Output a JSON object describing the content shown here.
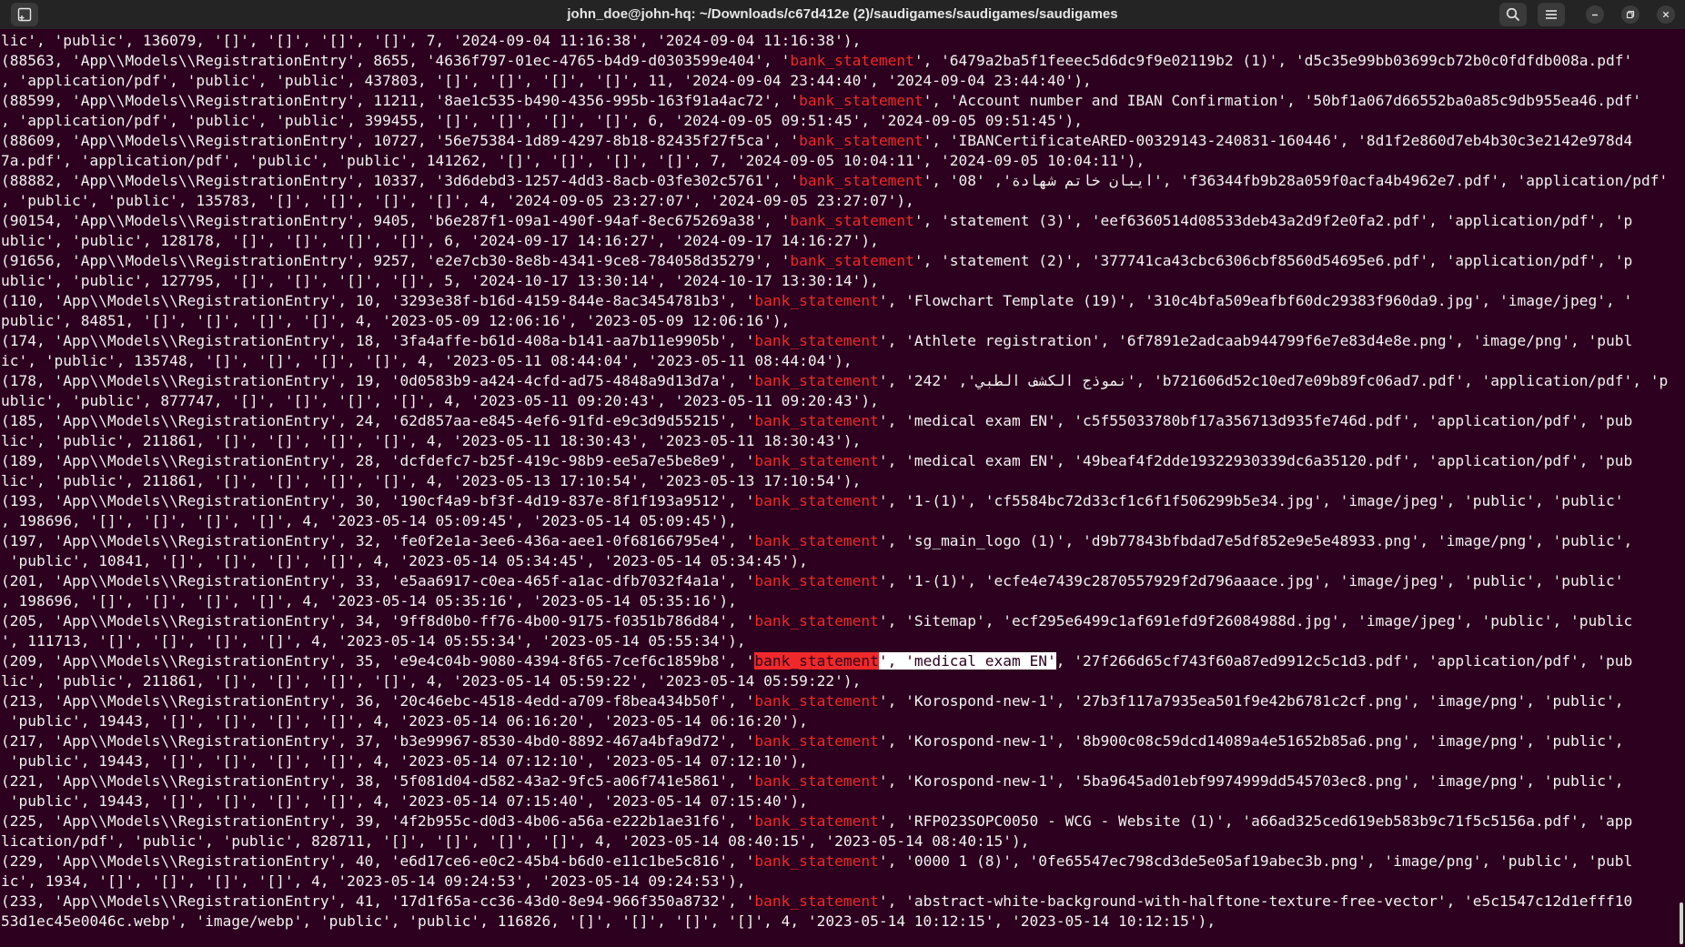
{
  "window": {
    "title": "john_doe@john-hq: ~/Downloads/c67d412e (2)/saudigames/saudigames/saudigames"
  },
  "icons": {
    "new_tab": "new-tab-icon",
    "search": "search-icon",
    "menu": "hamburger-menu-icon",
    "minimize": "minimize-icon",
    "maximize": "maximize-icon",
    "close": "close-icon"
  },
  "colors": {
    "background": "#2c001e",
    "highlight": "#ef2929",
    "text": "#f2f2f2"
  },
  "terminal": {
    "lines": [
      [
        {
          "t": "lic', 'public', 136079, '[]', '[]', '[]', '[]', 7, '2024-09-04 11:16:38', '2024-09-04 11:16:38'),"
        }
      ],
      [
        {
          "t": "(88563, 'App\\\\Models\\\\RegistrationEntry', 8655, '4636f797-01ec-4765-b4d9-d0303599e404', '"
        },
        {
          "t": "bank_statement",
          "c": "hl"
        },
        {
          "t": "', '6479a2ba5f1feeec5d6dc9f9e02119b2 (1)', 'd5c35e99bb03699cb72b0c0fdfdb008a.pdf'"
        }
      ],
      [
        {
          "t": ", 'application/pdf', 'public', 'public', 437803, '[]', '[]', '[]', '[]', 11, '2024-09-04 23:44:40', '2024-09-04 23:44:40'),"
        }
      ],
      [
        {
          "t": "(88599, 'App\\\\Models\\\\RegistrationEntry', 11211, '8ae1c535-b490-4356-995b-163f91a4ac72', '"
        },
        {
          "t": "bank_statement",
          "c": "hl"
        },
        {
          "t": "', 'Account number and IBAN Confirmation', '50bf1a067d66552ba0a85c9db955ea46.pdf'"
        }
      ],
      [
        {
          "t": ", 'application/pdf', 'public', 'public', 399455, '[]', '[]', '[]', '[]', 6, '2024-09-05 09:51:45', '2024-09-05 09:51:45'),"
        }
      ],
      [
        {
          "t": "(88609, 'App\\\\Models\\\\RegistrationEntry', 10727, '56e75384-1d89-4297-8b18-82435f27f5ca', '"
        },
        {
          "t": "bank_statement",
          "c": "hl"
        },
        {
          "t": "', 'IBANCertificateARED-00329143-240831-160446', '8d1f2e860d7eb4b30c3e2142e978d4"
        }
      ],
      [
        {
          "t": "7a.pdf', 'application/pdf', 'public', 'public', 141262, '[]', '[]', '[]', '[]', 7, '2024-09-05 10:04:11', '2024-09-05 10:04:11'),"
        }
      ],
      [
        {
          "t": "(88882, 'App\\\\Models\\\\RegistrationEntry', 10337, '3d6debd3-1257-4dd3-8acb-03fe302c5761', '"
        },
        {
          "t": "bank_statement",
          "c": "hl"
        },
        {
          "t": "', '08' ,'ايبان خاتم شهادة', 'f36344fb9b28a059f0acfa4b4962e7.pdf', 'application/pdf'"
        }
      ],
      [
        {
          "t": ", 'public', 'public', 135783, '[]', '[]', '[]', '[]', 4, '2024-09-05 23:27:07', '2024-09-05 23:27:07'),"
        }
      ],
      [
        {
          "t": "(90154, 'App\\\\Models\\\\RegistrationEntry', 9405, 'b6e287f1-09a1-490f-94af-8ec675269a38', '"
        },
        {
          "t": "bank_statement",
          "c": "hl"
        },
        {
          "t": "', 'statement (3)', 'eef6360514d08533deb43a2d9f2e0fa2.pdf', 'application/pdf', 'p"
        }
      ],
      [
        {
          "t": "ublic', 'public', 128178, '[]', '[]', '[]', '[]', 6, '2024-09-17 14:16:27', '2024-09-17 14:16:27'),"
        }
      ],
      [
        {
          "t": "(91656, 'App\\\\Models\\\\RegistrationEntry', 9257, 'e2e7cb30-8e8b-4341-9ce8-784058d35279', '"
        },
        {
          "t": "bank_statement",
          "c": "hl"
        },
        {
          "t": "', 'statement (2)', '377741ca43cbc6306cbf8560d54695e6.pdf', 'application/pdf', 'p"
        }
      ],
      [
        {
          "t": "ublic', 'public', 127795, '[]', '[]', '[]', '[]', 5, '2024-10-17 13:30:14', '2024-10-17 13:30:14'),"
        }
      ],
      [
        {
          "t": "(110, 'App\\\\Models\\\\RegistrationEntry', 10, '3293e38f-b16d-4159-844e-8ac3454781b3', '"
        },
        {
          "t": "bank_statement",
          "c": "hl"
        },
        {
          "t": "', 'Flowchart Template (19)', '310c4bfa509eafbf60dc29383f960da9.jpg', 'image/jpeg', '"
        }
      ],
      [
        {
          "t": "public', 84851, '[]', '[]', '[]', '[]', 4, '2023-05-09 12:06:16', '2023-05-09 12:06:16'),"
        }
      ],
      [
        {
          "t": "(174, 'App\\\\Models\\\\RegistrationEntry', 18, '3fa4affe-b61d-408a-b141-aa7b11e9905b', '"
        },
        {
          "t": "bank_statement",
          "c": "hl"
        },
        {
          "t": "', 'Athlete registration', '6f7891e2adcaab944799f6e7e83d4e8e.png', 'image/png', 'publ"
        }
      ],
      [
        {
          "t": "ic', 'public', 135748, '[]', '[]', '[]', '[]', 4, '2023-05-11 08:44:04', '2023-05-11 08:44:04'),"
        }
      ],
      [
        {
          "t": "(178, 'App\\\\Models\\\\RegistrationEntry', 19, '0d0583b9-a424-4cfd-ad75-4848a9d13d7a', '"
        },
        {
          "t": "bank_statement",
          "c": "hl"
        },
        {
          "t": "', '242' ,'نموذج الكشف الطبي', 'b721606d52c10ed7e09b89fc06ad7.pdf', 'application/pdf', 'p"
        }
      ],
      [
        {
          "t": "ublic', 'public', 877747, '[]', '[]', '[]', '[]', 4, '2023-05-11 09:20:43', '2023-05-11 09:20:43'),"
        }
      ],
      [
        {
          "t": "(185, 'App\\\\Models\\\\RegistrationEntry', 24, '62d857aa-e845-4ef6-91fd-e9c3d9d55215', '"
        },
        {
          "t": "bank_statement",
          "c": "hl"
        },
        {
          "t": "', 'medical exam EN', 'c5f55033780bf17a356713d935fe746d.pdf', 'application/pdf', 'pub"
        }
      ],
      [
        {
          "t": "lic', 'public', 211861, '[]', '[]', '[]', '[]', 4, '2023-05-11 18:30:43', '2023-05-11 18:30:43'),"
        }
      ],
      [
        {
          "t": "(189, 'App\\\\Models\\\\RegistrationEntry', 28, 'dcfdefc7-b25f-419c-98b9-ee5a7e5be8e9', '"
        },
        {
          "t": "bank_statement",
          "c": "hl"
        },
        {
          "t": "', 'medical exam EN', '49beaf4f2dde19322930339dc6a35120.pdf', 'application/pdf', 'pub"
        }
      ],
      [
        {
          "t": "lic', 'public', 211861, '[]', '[]', '[]', '[]', 4, '2023-05-13 17:10:54', '2023-05-13 17:10:54'),"
        }
      ],
      [
        {
          "t": "(193, 'App\\\\Models\\\\RegistrationEntry', 30, '190cf4a9-bf3f-4d19-837e-8f1f193a9512', '"
        },
        {
          "t": "bank_statement",
          "c": "hl"
        },
        {
          "t": "', '1-(1)', 'cf5584bc72d33cf1c6f1f506299b5e34.jpg', 'image/jpeg', 'public', 'public'"
        }
      ],
      [
        {
          "t": ", 198696, '[]', '[]', '[]', '[]', 4, '2023-05-14 05:09:45', '2023-05-14 05:09:45'),"
        }
      ],
      [
        {
          "t": "(197, 'App\\\\Models\\\\RegistrationEntry', 32, 'fe0f2e1a-3ee6-436a-aee1-0f68166795e4', '"
        },
        {
          "t": "bank_statement",
          "c": "hl"
        },
        {
          "t": "', 'sg_main_logo (1)', 'd9b77843bfbdad7e5df852e9e5e48933.png', 'image/png', 'public',"
        }
      ],
      [
        {
          "t": " 'public', 10841, '[]', '[]', '[]', '[]', 4, '2023-05-14 05:34:45', '2023-05-14 05:34:45'),"
        }
      ],
      [
        {
          "t": "(201, 'App\\\\Models\\\\RegistrationEntry', 33, 'e5aa6917-c0ea-465f-a1ac-dfb7032f4a1a', '"
        },
        {
          "t": "bank_statement",
          "c": "hl"
        },
        {
          "t": "', '1-(1)', 'ecfe4e7439c2870557929f2d796aaace.jpg', 'image/jpeg', 'public', 'public'"
        }
      ],
      [
        {
          "t": ", 198696, '[]', '[]', '[]', '[]', 4, '2023-05-14 05:35:16', '2023-05-14 05:35:16'),"
        }
      ],
      [
        {
          "t": "(205, 'App\\\\Models\\\\RegistrationEntry', 34, '9ff8d0b0-ff76-4b00-9175-f0351b786d84', '"
        },
        {
          "t": "bank_statement",
          "c": "hl"
        },
        {
          "t": "', 'Sitemap', 'ecf295e6499c1af691efd9f26084988d.jpg', 'image/jpeg', 'public', 'public"
        }
      ],
      [
        {
          "t": "', 111713, '[]', '[]', '[]', '[]', 4, '2023-05-14 05:55:34', '2023-05-14 05:55:34'),"
        }
      ],
      [
        {
          "t": "(209, 'App\\\\Models\\\\RegistrationEntry', 35, 'e9e4c04b-9080-4394-8f65-7cef6c1859b8', '"
        },
        {
          "t": "bank_statement",
          "c": "hl sel-hl"
        },
        {
          "t": "', 'medical exam EN'",
          "c": "sel"
        },
        {
          "t": ", '27f266d65cf743f60a87ed9912c5c1d3.pdf', 'application/pdf', 'pub"
        }
      ],
      [
        {
          "t": "lic', 'public', 211861, '[]', '[]', '[]', '[]', 4, '2023-05-14 05:59:22', '2023-05-14 05:59:22'),"
        }
      ],
      [
        {
          "t": "(213, 'App\\\\Models\\\\RegistrationEntry', 36, '20c46ebc-4518-4edd-a709-f8bea434b50f', '"
        },
        {
          "t": "bank_statement",
          "c": "hl"
        },
        {
          "t": "', 'Korospond-new-1', '27b3f117a7935ea501f9e42b6781c2cf.png', 'image/png', 'public',"
        }
      ],
      [
        {
          "t": " 'public', 19443, '[]', '[]', '[]', '[]', 4, '2023-05-14 06:16:20', '2023-05-14 06:16:20'),"
        }
      ],
      [
        {
          "t": "(217, 'App\\\\Models\\\\RegistrationEntry', 37, 'b3e99967-8530-4bd0-8892-467a4bfa9d72', '"
        },
        {
          "t": "bank_statement",
          "c": "hl"
        },
        {
          "t": "', 'Korospond-new-1', '8b900c08c59dcd14089a4e51652b85a6.png', 'image/png', 'public',"
        }
      ],
      [
        {
          "t": " 'public', 19443, '[]', '[]', '[]', '[]', 4, '2023-05-14 07:12:10', '2023-05-14 07:12:10'),"
        }
      ],
      [
        {
          "t": "(221, 'App\\\\Models\\\\RegistrationEntry', 38, '5f081d04-d582-43a2-9fc5-a06f741e5861', '"
        },
        {
          "t": "bank_statement",
          "c": "hl"
        },
        {
          "t": "', 'Korospond-new-1', '5ba9645ad01ebf9974999dd545703ec8.png', 'image/png', 'public',"
        }
      ],
      [
        {
          "t": " 'public', 19443, '[]', '[]', '[]', '[]', 4, '2023-05-14 07:15:40', '2023-05-14 07:15:40'),"
        }
      ],
      [
        {
          "t": "(225, 'App\\\\Models\\\\RegistrationEntry', 39, '4f2b955c-d0d3-4b06-a56a-e222b1ae31f6', '"
        },
        {
          "t": "bank_statement",
          "c": "hl"
        },
        {
          "t": "', 'RFP023SOPC0050 - WCG - Website (1)', 'a66ad325ced619eb583b9c71f5c5156a.pdf', 'app"
        }
      ],
      [
        {
          "t": "lication/pdf', 'public', 'public', 828711, '[]', '[]', '[]', '[]', 4, '2023-05-14 08:40:15', '2023-05-14 08:40:15'),"
        }
      ],
      [
        {
          "t": "(229, 'App\\\\Models\\\\RegistrationEntry', 40, 'e6d17ce6-e0c2-45b4-b6d0-e11c1be5c816', '"
        },
        {
          "t": "bank_statement",
          "c": "hl"
        },
        {
          "t": "', '0000 1 (8)', '0fe65547ec798cd3de5e05af19abec3b.png', 'image/png', 'public', 'publ"
        }
      ],
      [
        {
          "t": "ic', 1934, '[]', '[]', '[]', '[]', 4, '2023-05-14 09:24:53', '2023-05-14 09:24:53'),"
        }
      ],
      [
        {
          "t": "(233, 'App\\\\Models\\\\RegistrationEntry', 41, '17d1f65a-cc36-43d0-8e94-966f350a8732', '"
        },
        {
          "t": "bank_statement",
          "c": "hl"
        },
        {
          "t": "', 'abstract-white-background-with-halftone-texture-free-vector', 'e5c1547c12d1efff10"
        }
      ],
      [
        {
          "t": "53d1ec45e0046c.webp', 'image/webp', 'public', 'public', 116826, '[]', '[]', '[]', '[]', 4, '2023-05-14 10:12:15', '2023-05-14 10:12:15'),"
        }
      ]
    ]
  }
}
